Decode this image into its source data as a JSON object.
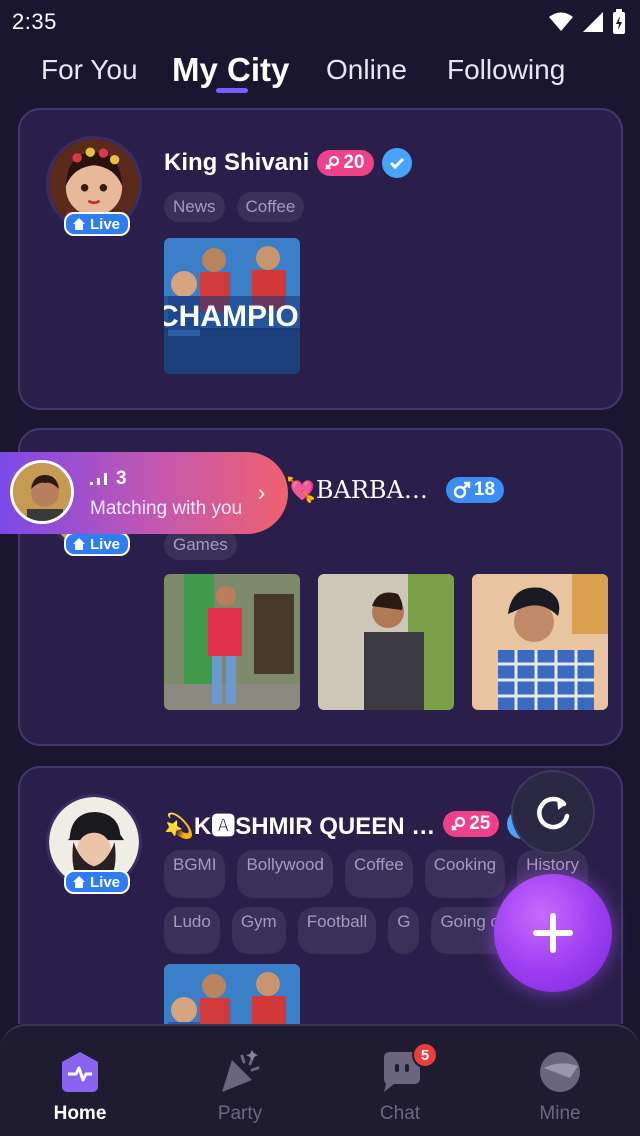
{
  "status_bar": {
    "time": "2:35"
  },
  "tabs": [
    {
      "label": "For You",
      "active": false
    },
    {
      "label": "My City",
      "active": true
    },
    {
      "label": "Online",
      "active": false
    },
    {
      "label": "Following",
      "active": false
    }
  ],
  "cards": [
    {
      "name": "King Shivani",
      "gender": "female",
      "level": "20",
      "verified": true,
      "live_label": "Live",
      "tags": [
        "News",
        "Coffee"
      ],
      "photo_text": "CHAMPIOI"
    },
    {
      "name": "💘BARBA…",
      "gender": "male",
      "level": "18",
      "live_label": "Live",
      "tags": [
        "Games"
      ]
    },
    {
      "name": "💫K🅰SHMIR QUEEN …",
      "gender": "female",
      "level": "25",
      "verified": true,
      "live_label": "Live",
      "tags": [
        "BGMI",
        "Bollywood",
        "Coffee",
        "Cooking",
        "History",
        "Ludo",
        "Gym",
        "Football",
        "G",
        "Going out"
      ]
    }
  ],
  "matching_banner": {
    "count": "3",
    "text": "Matching with you"
  },
  "bottom_nav": [
    {
      "label": "Home",
      "active": true
    },
    {
      "label": "Party",
      "active": false
    },
    {
      "label": "Chat",
      "active": false,
      "badge": "5"
    },
    {
      "label": "Mine",
      "active": false
    }
  ],
  "colors": {
    "background": "#1a1630",
    "card": "#2a1f4a",
    "accent": "#7a5cff",
    "female_pill": "#f0408a",
    "male_pill": "#3a8ff5",
    "live_badge": "#2f7df6"
  }
}
